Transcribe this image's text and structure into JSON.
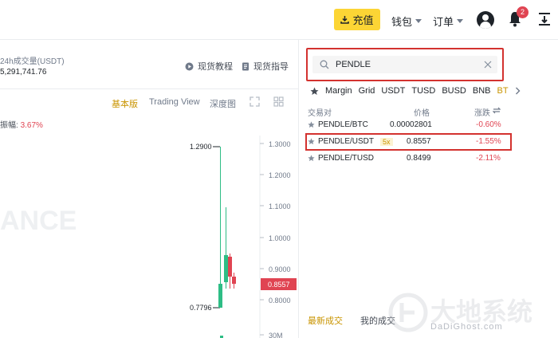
{
  "topbar": {
    "deposit_label": "充值",
    "wallet_label": "钱包",
    "orders_label": "订单",
    "notification_count": "2"
  },
  "ticker": {
    "volume_label": "24h成交量(USDT)",
    "volume_value": "5,291,741.76",
    "spot_tutorial": "现货教程",
    "spot_guide": "现货指导"
  },
  "chart_tabs": {
    "basic": "基本版",
    "tradingview": "Trading View",
    "depth": "深度图"
  },
  "chart": {
    "amplitude_label": "振幅:",
    "amplitude_value": "3.67%",
    "high_label": "1.2900",
    "low_label": "0.7796",
    "current_price": "0.8557",
    "watermark": "ANCE",
    "axis_labels": [
      "1.3000",
      "1.2000",
      "1.1000",
      "1.0000",
      "0.9000",
      "0.8000",
      "30M"
    ]
  },
  "market": {
    "search_value": "PENDLE",
    "categories": [
      "Margin",
      "Grid",
      "USDT",
      "TUSD",
      "BUSD",
      "BNB",
      "BT"
    ],
    "selected_category": "BT",
    "columns": {
      "pair": "交易对",
      "price": "价格",
      "change": "涨跌"
    },
    "rows": [
      {
        "pair": "PENDLE/BTC",
        "leverage": "",
        "price": "0.00002801",
        "change": "-0.60%"
      },
      {
        "pair": "PENDLE/USDT",
        "leverage": "5x",
        "price": "0.8557",
        "change": "-1.55%"
      },
      {
        "pair": "PENDLE/TUSD",
        "leverage": "",
        "price": "0.8499",
        "change": "-2.11%"
      }
    ],
    "trade_tabs": {
      "latest": "最新成交",
      "mine": "我的成交"
    }
  },
  "watermark": {
    "main": "大地系统",
    "sub": "DaDiGhost.com"
  },
  "colors": {
    "accent": "#fcd535",
    "gold_text": "#c99400",
    "down": "#e04452",
    "up": "#2ebd85",
    "highlight_box": "#d3322f"
  }
}
